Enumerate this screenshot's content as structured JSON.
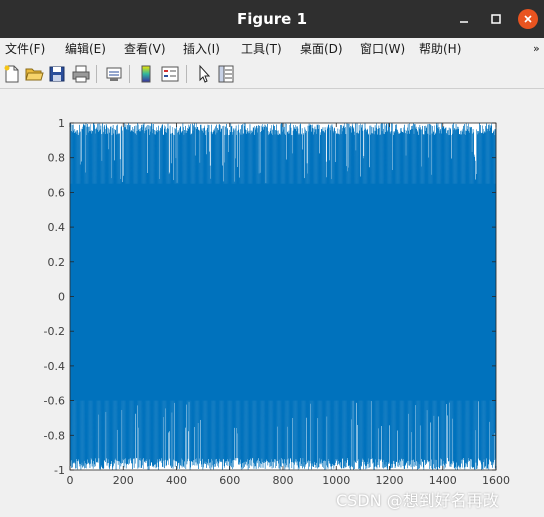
{
  "window": {
    "title": "Figure 1"
  },
  "menu": {
    "items": [
      {
        "label": "文件(F)"
      },
      {
        "label": "编辑(E)"
      },
      {
        "label": "查看(V)"
      },
      {
        "label": "插入(I)"
      },
      {
        "label": "工具(T)"
      },
      {
        "label": "桌面(D)"
      },
      {
        "label": "窗口(W)"
      },
      {
        "label": "帮助(H)"
      }
    ],
    "overflow_icon": "double-chevron-right-icon"
  },
  "toolbar": {
    "tools": [
      {
        "icon": "new-figure-icon"
      },
      {
        "icon": "open-file-icon"
      },
      {
        "icon": "save-icon"
      },
      {
        "icon": "print-icon"
      },
      {
        "icon": "link-plot-icon"
      },
      {
        "icon": "insert-colorbar-icon"
      },
      {
        "icon": "insert-legend-icon"
      },
      {
        "icon": "edit-plot-cursor-icon"
      },
      {
        "icon": "property-inspector-icon"
      }
    ]
  },
  "colors": {
    "line": "#0072bd",
    "titlebar": "#2f2f2f",
    "close_button": "#e95420",
    "axes_bg": "#ffffff"
  },
  "watermark": "CSDN @想到好名再改",
  "chart_data": {
    "type": "line",
    "title": "",
    "xlabel": "",
    "ylabel": "",
    "xlim": [
      0,
      1600
    ],
    "ylim": [
      -1,
      1
    ],
    "xticks": [
      "0",
      "200",
      "400",
      "600",
      "800",
      "1000",
      "1200",
      "1400",
      "1600"
    ],
    "yticks": [
      "1",
      "0.8",
      "0.6",
      "0.4",
      "0.2",
      "0",
      "-0.2",
      "-0.4",
      "-0.6",
      "-0.8",
      "-1"
    ],
    "grid": false,
    "series": [
      {
        "name": "",
        "description_x": [
          1,
          1600
        ],
        "upper_envelope_peak": 1,
        "upper_envelope_typical_min": 0.65,
        "lower_envelope_peak": -1,
        "lower_envelope_typical_max": -0.6,
        "color": "#0072bd"
      }
    ]
  }
}
